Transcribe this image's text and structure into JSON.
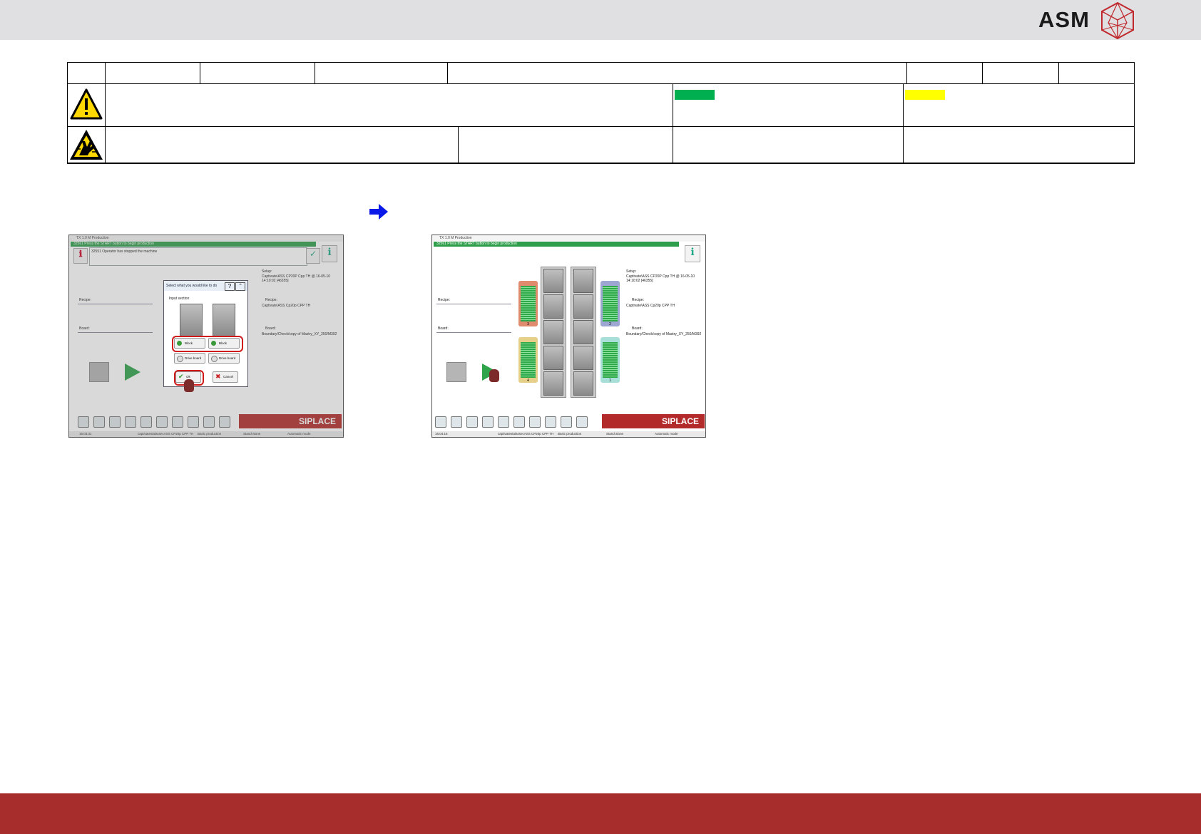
{
  "header": {
    "logo_text": "ASM"
  },
  "colors": {
    "header_bg": "#e0e0e2",
    "footer_bg": "#a72d2d",
    "swatch_green": "#00b050",
    "swatch_yellow": "#ffff00",
    "arrow_blue": "#0000ff",
    "siplace_red": "#b32a2a",
    "status_green": "#2f9e4b"
  },
  "icons": {
    "warning": "warning-triangle-icon",
    "esd": "esd-hand-icon",
    "arrow": "arrow-right-icon",
    "logo": "asm-logo-icon"
  },
  "screenshot_left": {
    "title": "TX 1.0 M Production",
    "status": "32561 Press the START button to begin production",
    "message": "32551 Operator has stopped the machine",
    "setup_label": "Setup:",
    "setup_value": "Captivate\\ASS CP20P Cpp TH @ 16-05-10 14:10:02 [46355]",
    "recipe_label": "Recipe:",
    "recipe_value": "Captivate\\ASS Cp20p CPP TH",
    "board_label": "Board:",
    "board_value": "Boundary/Check/copy of Mastry_XY_250/M392",
    "dialog": {
      "title": "Select what you would like to do",
      "section": "Input section",
      "block_1": "Block",
      "block_2": "Block",
      "drive_1": "Drive board",
      "drive_2": "Drive board",
      "ok": "Ok",
      "cancel": "Cancel"
    },
    "brand": "SIPLACE",
    "bottom_time": "16:03:31",
    "bottom_setup": "captivatestalassecASS CP20p CPP TH",
    "bottom_mode1": "Basic production",
    "bottom_mode2": "Stand-alone",
    "bottom_mode3": "Automatic mode"
  },
  "screenshot_right": {
    "title": "TX 1.0 M Production",
    "status": "32561 Press the START button to begin production",
    "setup_label": "Setup:",
    "setup_value": "Captivate\\ASS CP20P Cpp TH @ 16-05-10 14:10:02 [46355]",
    "recipe_label": "Recipe:",
    "recipe_value": "Captivate\\ASS Cp20p CPP TH",
    "board_label": "Board:",
    "board_value": "Boundary/Check/copy of Mastry_XY_250/M392",
    "feeder_1": "1",
    "feeder_2": "2",
    "feeder_3": "3",
    "feeder_4": "4",
    "brand": "SIPLACE",
    "bottom_time": "16:04:16",
    "bottom_setup": "captivatestalassecASS CP20p CPP TH",
    "bottom_mode1": "Basic production",
    "bottom_mode2": "Stand alone",
    "bottom_mode3": "Automatic mode"
  }
}
